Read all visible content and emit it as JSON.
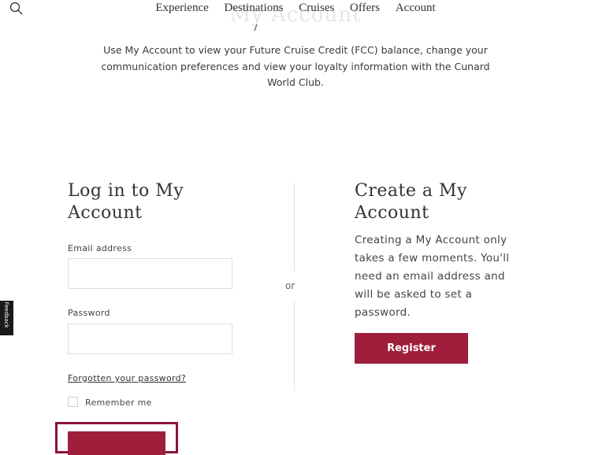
{
  "nav": {
    "links": [
      "Experience",
      "Destinations",
      "Cruises",
      "Offers",
      "Account"
    ]
  },
  "header": {
    "title": "My Account",
    "intro": "Use My Account to view your Future Cruise Credit (FCC) balance, change your communication preferences and view your loyalty information with the Cunard World Club."
  },
  "login": {
    "title": "Log in to My Account",
    "email_label": "Email address",
    "email_value": "",
    "password_label": "Password",
    "password_value": "",
    "forgot_label": "Forgotten your password?",
    "remember_label": "Remember me",
    "signin_label": ""
  },
  "separator": {
    "or_label": "or"
  },
  "create": {
    "title": "Create a My Account",
    "text": "Creating a My Account only takes a few moments. You'll need an email address and will be asked to set a password.",
    "register_label": "Register"
  },
  "feedback_tab": {
    "label": "Feedback"
  },
  "colors": {
    "accent": "#9f1e3c",
    "highlight": "#8a1538"
  }
}
